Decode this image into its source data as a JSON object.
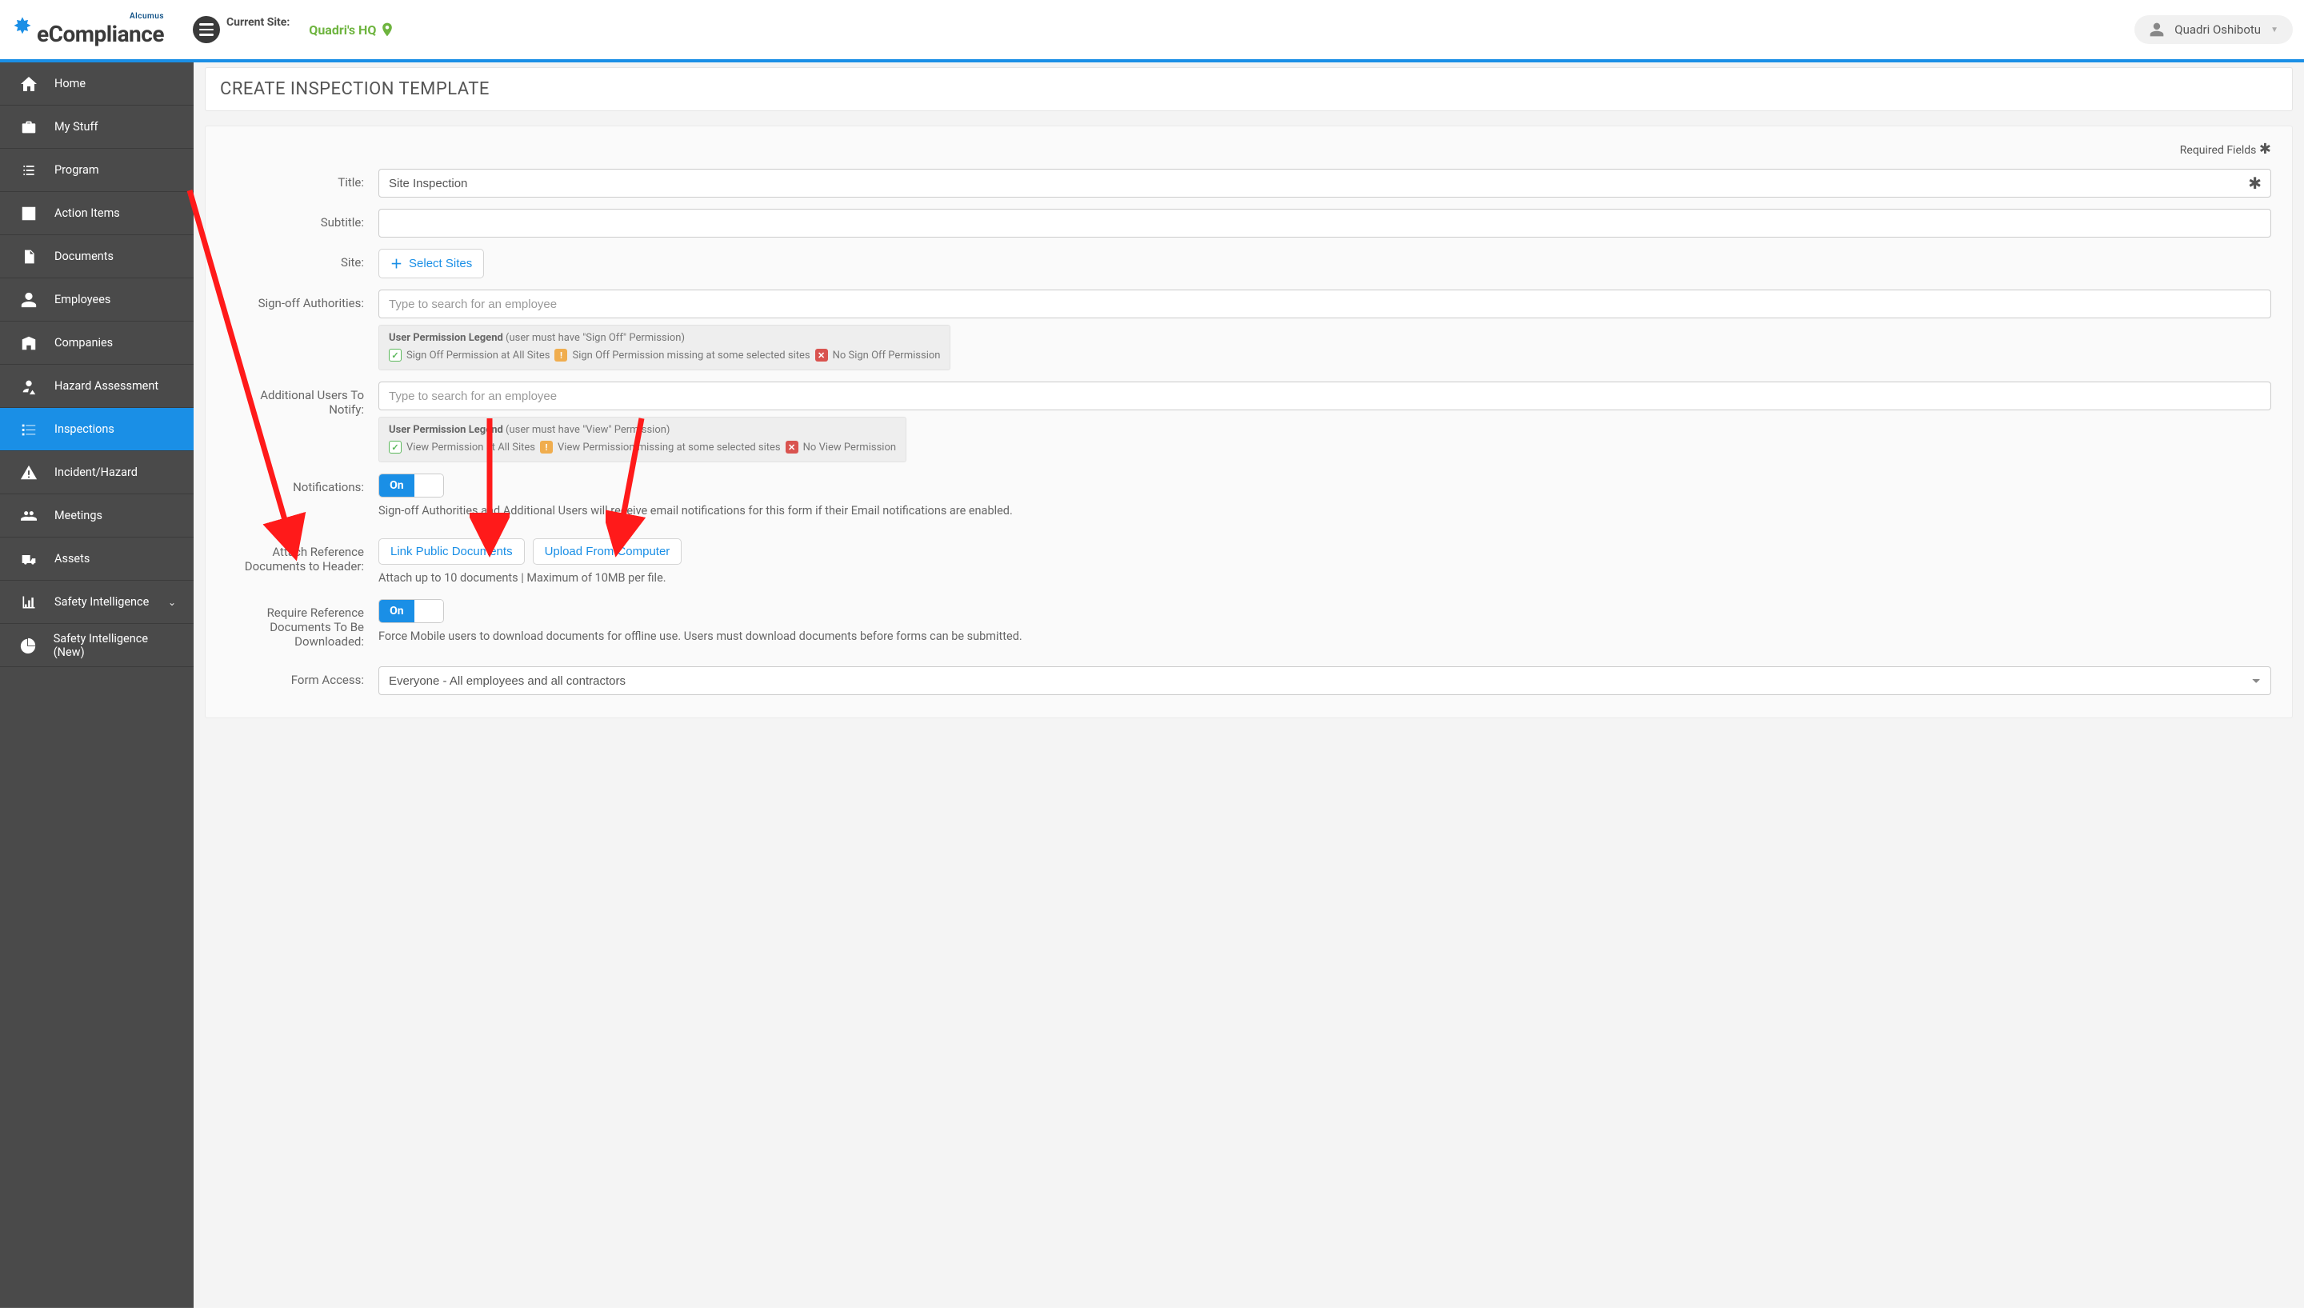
{
  "header": {
    "brand_company": "Alcumus",
    "brand_name": "eCompliance",
    "current_site_label": "Current Site:",
    "site_name": "Quadri's HQ",
    "user_name": "Quadri Oshibotu"
  },
  "sidebar": {
    "items": [
      {
        "label": "Home"
      },
      {
        "label": "My Stuff"
      },
      {
        "label": "Program"
      },
      {
        "label": "Action Items"
      },
      {
        "label": "Documents"
      },
      {
        "label": "Employees"
      },
      {
        "label": "Companies"
      },
      {
        "label": "Hazard Assessment"
      },
      {
        "label": "Inspections"
      },
      {
        "label": "Incident/Hazard"
      },
      {
        "label": "Meetings"
      },
      {
        "label": "Assets"
      },
      {
        "label": "Safety Intelligence"
      },
      {
        "label": "Safety Intelligence (New)"
      }
    ]
  },
  "page": {
    "title": "CREATE INSPECTION TEMPLATE",
    "required_fields_label": "Required Fields"
  },
  "form": {
    "title_label": "Title:",
    "title_value": "Site Inspection",
    "subtitle_label": "Subtitle:",
    "subtitle_value": "",
    "site_label": "Site:",
    "select_sites_btn": "Select Sites",
    "signoff_label": "Sign-off Authorities:",
    "signoff_placeholder": "Type to search for an employee",
    "legend_title": "User Permission Legend",
    "legend_signoff_hint": "(user must have \"Sign Off\" Permission)",
    "legend_signoff_green": "Sign Off Permission at All Sites",
    "legend_signoff_orange": "Sign Off Permission missing at some selected sites",
    "legend_signoff_red": "No Sign Off Permission",
    "addl_users_label": "Additional Users To Notify:",
    "addl_users_placeholder": "Type to search for an employee",
    "legend_view_hint": "(user must have \"View\" Permission)",
    "legend_view_green": "View Permission at All Sites",
    "legend_view_orange": "View Permission missing at some selected sites",
    "legend_view_red": "No View Permission",
    "notifications_label": "Notifications:",
    "toggle_on": "On",
    "notifications_help": "Sign-off Authorities and Additional Users will receive email notifications for this form if their Email notifications are enabled.",
    "attach_label_l1": "Attach Reference",
    "attach_label_l2": "Documents to Header:",
    "link_docs_btn": "Link Public Documents",
    "upload_btn": "Upload From Computer",
    "attach_help": "Attach up to 10 documents | Maximum of 10MB per file.",
    "require_dl_l1": "Require Reference",
    "require_dl_l2": "Documents To Be",
    "require_dl_l3": "Downloaded:",
    "require_dl_help": "Force Mobile users to download documents for offline use. Users must download documents before forms can be submitted.",
    "form_access_label": "Form Access:",
    "form_access_value": "Everyone - All employees and all contractors"
  }
}
